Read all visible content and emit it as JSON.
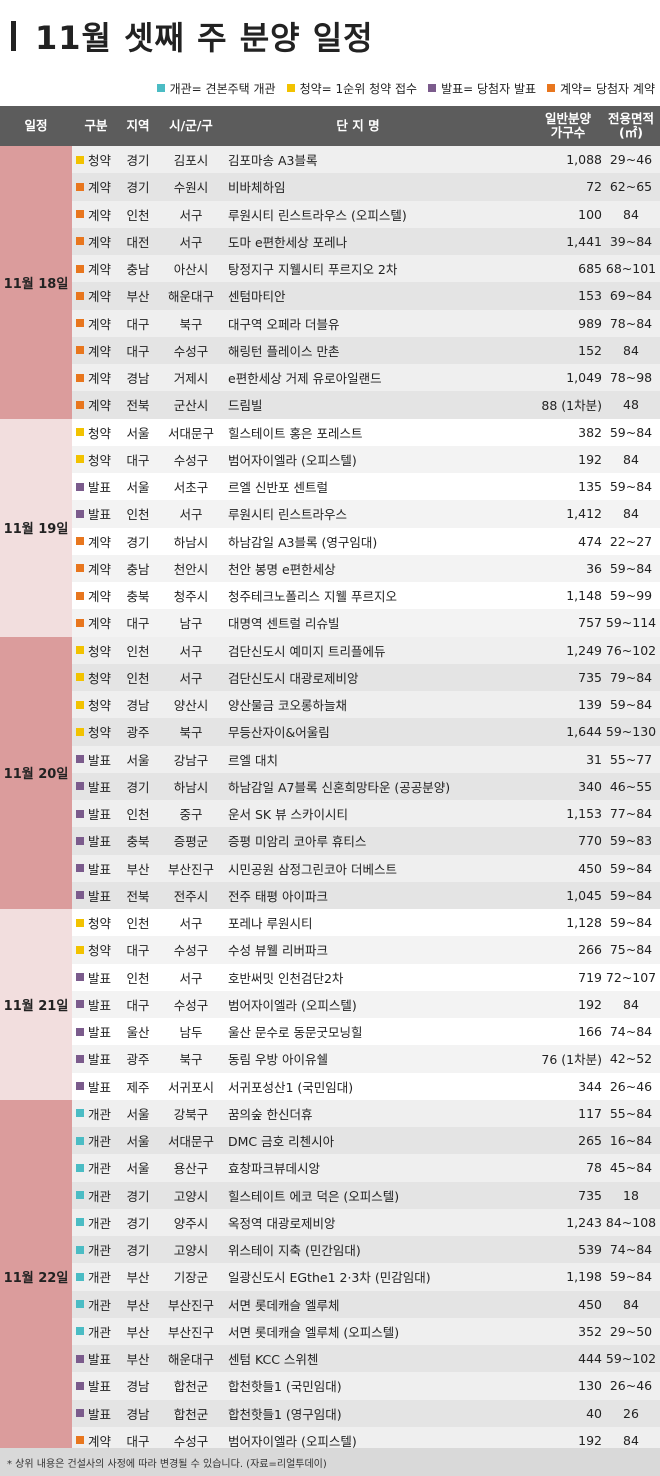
{
  "title": "11월 셋째 주 분양 일정",
  "legend": [
    {
      "label": "개관= 견본주택 개관",
      "color": "#4bbcc4"
    },
    {
      "label": "청약= 1순위 청약 접수",
      "color": "#f2c200"
    },
    {
      "label": "발표= 당첨자 발표",
      "color": "#7b5b8c"
    },
    {
      "label": "계약= 당첨자 계약",
      "color": "#e8761e"
    }
  ],
  "type_colors": {
    "개관": "#4bbcc4",
    "청약": "#f2c200",
    "발표": "#7b5b8c",
    "계약": "#e8761e"
  },
  "header": {
    "date": "일정",
    "type": "구분",
    "region": "지역",
    "city": "시/군/구",
    "name": "단 지 명",
    "units_line1": "일반분양",
    "units_line2": "가구수",
    "area_line1": "전용면적",
    "area_line2": "(㎡)"
  },
  "groups": [
    {
      "date": "11월 18일",
      "bg": "#db9c9c",
      "rowbg": [
        "#efefef",
        "#e4e4e4"
      ],
      "rows": [
        {
          "type": "청약",
          "region": "경기",
          "city": "김포시",
          "name": "김포마송 A3블록",
          "units": "1,088",
          "area": "29~46"
        },
        {
          "type": "계약",
          "region": "경기",
          "city": "수원시",
          "name": "비바체하임",
          "units": "72",
          "area": "62~65"
        },
        {
          "type": "계약",
          "region": "인천",
          "city": "서구",
          "name": "루원시티 린스트라우스 (오피스텔)",
          "units": "100",
          "area": "84"
        },
        {
          "type": "계약",
          "region": "대전",
          "city": "서구",
          "name": "도마 e편한세상 포레나",
          "units": "1,441",
          "area": "39~84"
        },
        {
          "type": "계약",
          "region": "충남",
          "city": "아산시",
          "name": "탕정지구 지웰시티 푸르지오 2차",
          "units": "685",
          "area": "68~101"
        },
        {
          "type": "계약",
          "region": "부산",
          "city": "해운대구",
          "name": "센텀마티안",
          "units": "153",
          "area": "69~84"
        },
        {
          "type": "계약",
          "region": "대구",
          "city": "북구",
          "name": "대구역 오페라 더블유",
          "units": "989",
          "area": "78~84"
        },
        {
          "type": "계약",
          "region": "대구",
          "city": "수성구",
          "name": "해링턴 플레이스 만촌",
          "units": "152",
          "area": "84"
        },
        {
          "type": "계약",
          "region": "경남",
          "city": "거제시",
          "name": "e편한세상 거제 유로아일랜드",
          "units": "1,049",
          "area": "78~98"
        },
        {
          "type": "계약",
          "region": "전북",
          "city": "군산시",
          "name": "드림빌",
          "units": "88 (1차분)",
          "area": "48"
        }
      ]
    },
    {
      "date": "11월 19일",
      "bg": "#f2dede",
      "rowbg": [
        "#ffffff",
        "#f3f3f3"
      ],
      "rows": [
        {
          "type": "청약",
          "region": "서울",
          "city": "서대문구",
          "name": "힐스테이트 홍은 포레스트",
          "units": "382",
          "area": "59~84"
        },
        {
          "type": "청약",
          "region": "대구",
          "city": "수성구",
          "name": "범어자이엘라 (오피스텔)",
          "units": "192",
          "area": "84"
        },
        {
          "type": "발표",
          "region": "서울",
          "city": "서초구",
          "name": "르엘 신반포 센트럴",
          "units": "135",
          "area": "59~84"
        },
        {
          "type": "발표",
          "region": "인천",
          "city": "서구",
          "name": "루원시티 린스트라우스",
          "units": "1,412",
          "area": "84"
        },
        {
          "type": "계약",
          "region": "경기",
          "city": "하남시",
          "name": "하남감일 A3블록 (영구임대)",
          "units": "474",
          "area": "22~27"
        },
        {
          "type": "계약",
          "region": "충남",
          "city": "천안시",
          "name": "천안 봉명 e편한세상",
          "units": "36",
          "area": "59~84"
        },
        {
          "type": "계약",
          "region": "충북",
          "city": "청주시",
          "name": "청주테크노폴리스 지웰 푸르지오",
          "units": "1,148",
          "area": "59~99"
        },
        {
          "type": "계약",
          "region": "대구",
          "city": "남구",
          "name": "대명역 센트럴 리슈빌",
          "units": "757",
          "area": "59~114"
        }
      ]
    },
    {
      "date": "11월 20일",
      "bg": "#db9c9c",
      "rowbg": [
        "#efefef",
        "#e4e4e4"
      ],
      "rows": [
        {
          "type": "청약",
          "region": "인천",
          "city": "서구",
          "name": "검단신도시 예미지 트리플에듀",
          "units": "1,249",
          "area": "76~102"
        },
        {
          "type": "청약",
          "region": "인천",
          "city": "서구",
          "name": "검단신도시 대광로제비앙",
          "units": "735",
          "area": "79~84"
        },
        {
          "type": "청약",
          "region": "경남",
          "city": "양산시",
          "name": "양산물금 코오롱하늘채",
          "units": "139",
          "area": "59~84"
        },
        {
          "type": "청약",
          "region": "광주",
          "city": "북구",
          "name": "무등산자이&어울림",
          "units": "1,644",
          "area": "59~130"
        },
        {
          "type": "발표",
          "region": "서울",
          "city": "강남구",
          "name": "르엘 대치",
          "units": "31",
          "area": "55~77"
        },
        {
          "type": "발표",
          "region": "경기",
          "city": "하남시",
          "name": "하남감일 A7블록 신혼희망타운 (공공분양)",
          "units": "340",
          "area": "46~55"
        },
        {
          "type": "발표",
          "region": "인천",
          "city": "중구",
          "name": "운서 SK 뷰 스카이시티",
          "units": "1,153",
          "area": "77~84"
        },
        {
          "type": "발표",
          "region": "충북",
          "city": "증평군",
          "name": "증평 미암리 코아루 휴티스",
          "units": "770",
          "area": "59~83"
        },
        {
          "type": "발표",
          "region": "부산",
          "city": "부산진구",
          "name": "시민공원 삼정그린코아 더베스트",
          "units": "450",
          "area": "59~84"
        },
        {
          "type": "발표",
          "region": "전북",
          "city": "전주시",
          "name": "전주 태평 아이파크",
          "units": "1,045",
          "area": "59~84"
        }
      ]
    },
    {
      "date": "11월 21일",
      "bg": "#f2dede",
      "rowbg": [
        "#ffffff",
        "#f3f3f3"
      ],
      "rows": [
        {
          "type": "청약",
          "region": "인천",
          "city": "서구",
          "name": "포레나 루원시티",
          "units": "1,128",
          "area": "59~84"
        },
        {
          "type": "청약",
          "region": "대구",
          "city": "수성구",
          "name": "수성 뷰웰 리버파크",
          "units": "266",
          "area": "75~84"
        },
        {
          "type": "발표",
          "region": "인천",
          "city": "서구",
          "name": "호반써밋 인천검단2차",
          "units": "719",
          "area": "72~107"
        },
        {
          "type": "발표",
          "region": "대구",
          "city": "수성구",
          "name": "범어자이엘라 (오피스텔)",
          "units": "192",
          "area": "84"
        },
        {
          "type": "발표",
          "region": "울산",
          "city": "남두",
          "name": "울산 문수로 동문굿모닝힐",
          "units": "166",
          "area": "74~84"
        },
        {
          "type": "발표",
          "region": "광주",
          "city": "북구",
          "name": "동림 우방 아이유쉘",
          "units": "76 (1차분)",
          "area": "42~52"
        },
        {
          "type": "발표",
          "region": "제주",
          "city": "서귀포시",
          "name": "서귀포성산1 (국민임대)",
          "units": "344",
          "area": "26~46"
        }
      ]
    },
    {
      "date": "11월 22일",
      "bg": "#db9c9c",
      "rowbg": [
        "#efefef",
        "#e4e4e4"
      ],
      "rows": [
        {
          "type": "개관",
          "region": "서울",
          "city": "강북구",
          "name": "꿈의숲 한신더휴",
          "units": "117",
          "area": "55~84"
        },
        {
          "type": "개관",
          "region": "서울",
          "city": "서대문구",
          "name": "DMC 금호 리첸시아",
          "units": "265",
          "area": "16~84"
        },
        {
          "type": "개관",
          "region": "서울",
          "city": "용산구",
          "name": "효창파크뷰데시앙",
          "units": "78",
          "area": "45~84"
        },
        {
          "type": "개관",
          "region": "경기",
          "city": "고양시",
          "name": "힐스테이트 에코 덕은 (오피스텔)",
          "units": "735",
          "area": "18"
        },
        {
          "type": "개관",
          "region": "경기",
          "city": "양주시",
          "name": "옥정역 대광로제비앙",
          "units": "1,243",
          "area": "84~108"
        },
        {
          "type": "개관",
          "region": "경기",
          "city": "고양시",
          "name": "위스테이 지축 (민간임대)",
          "units": "539",
          "area": "74~84"
        },
        {
          "type": "개관",
          "region": "부산",
          "city": "기장군",
          "name": "일광신도시 EGthe1 2·3차 (민감임대)",
          "units": "1,198",
          "area": "59~84"
        },
        {
          "type": "개관",
          "region": "부산",
          "city": "부산진구",
          "name": "서면 롯데캐슬 엘루체",
          "units": "450",
          "area": "84"
        },
        {
          "type": "개관",
          "region": "부산",
          "city": "부산진구",
          "name": "서면 롯데캐슬 엘루체 (오피스텔)",
          "units": "352",
          "area": "29~50"
        },
        {
          "type": "발표",
          "region": "부산",
          "city": "해운대구",
          "name": "센텀 KCC 스위첸",
          "units": "444",
          "area": "59~102"
        },
        {
          "type": "발표",
          "region": "경남",
          "city": "합천군",
          "name": "합천핫들1 (국민임대)",
          "units": "130",
          "area": "26~46"
        },
        {
          "type": "발표",
          "region": "경남",
          "city": "합천군",
          "name": "합천핫들1 (영구임대)",
          "units": "40",
          "area": "26"
        },
        {
          "type": "계약",
          "region": "대구",
          "city": "수성구",
          "name": "범어자이엘라 (오피스텔)",
          "units": "192",
          "area": "84"
        }
      ]
    }
  ],
  "footer": "* 상위 내용은 건설사의 사정에 따라 변경될 수 있습니다. (자료=리얼투데이)"
}
